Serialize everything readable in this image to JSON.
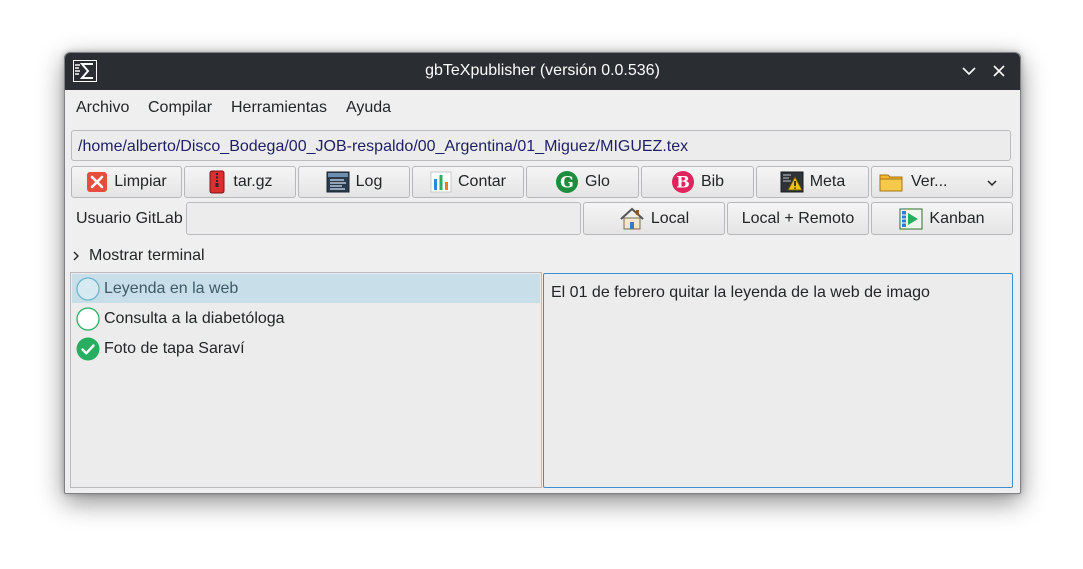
{
  "window": {
    "title": "gbTeXpublisher (versión 0.0.536)"
  },
  "menu": [
    "Archivo",
    "Compilar",
    "Herramientas",
    "Ayuda"
  ],
  "path": "/home/alberto/Disco_Bodega/00_JOB-respaldo/00_Argentina/01_Miguez/MIGUEZ.tex",
  "toolbar": {
    "limpiar": "Limpiar",
    "targz": "tar.gz",
    "log": "Log",
    "contar": "Contar",
    "glo": "Glo",
    "bib": "Bib",
    "meta": "Meta",
    "ver": "Ver..."
  },
  "gitlab": {
    "label": "Usuario GitLab",
    "value": "",
    "local": "Local",
    "local_remoto": "Local + Remoto",
    "kanban": "Kanban"
  },
  "terminal": {
    "label": "Mostrar terminal"
  },
  "tasks": [
    {
      "label": "Leyenda en la web",
      "status": "pending",
      "selected": true
    },
    {
      "label": "Consulta a la diabetóloga",
      "status": "pending",
      "selected": false
    },
    {
      "label": "Foto de tapa Saraví",
      "status": "done",
      "selected": false
    }
  ],
  "notes": {
    "text": "El 01 de febrero quitar la leyenda de la web de imago"
  },
  "colors": {
    "titlebar": "#2a2e32",
    "selection": "#c8dfe9",
    "focus_border": "#3d8fd1",
    "done_green": "#27ae60"
  }
}
